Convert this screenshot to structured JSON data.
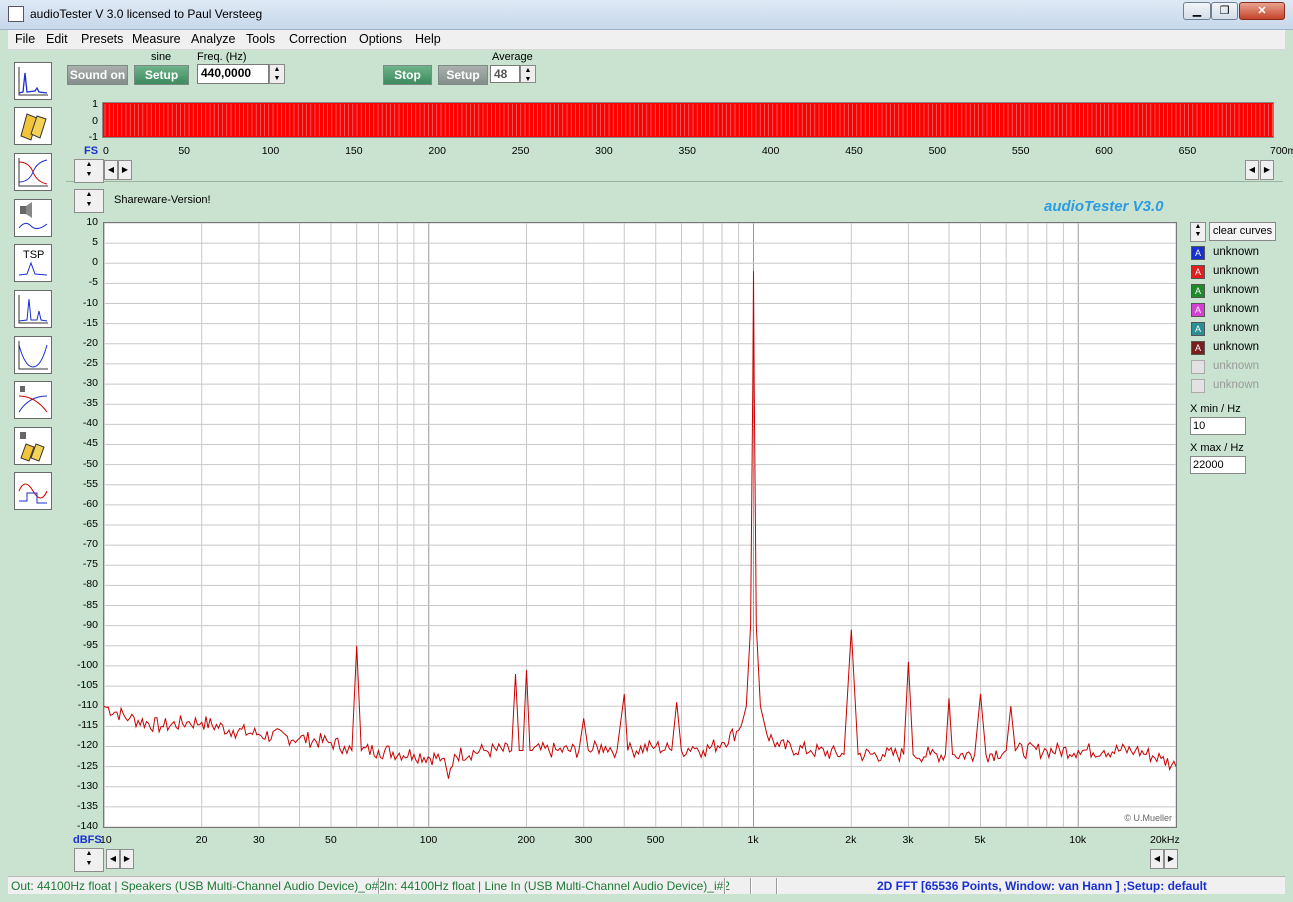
{
  "window": {
    "title": "audioTester  V 3.0   licensed to Paul Versteeg",
    "minimize_icon": "minimize-icon",
    "maximize_icon": "maximize-icon",
    "close_icon": "close-icon"
  },
  "menu": [
    "File",
    "Edit",
    "Presets",
    "Measure",
    "Analyze",
    "Tools",
    "Correction",
    "Options",
    "Help"
  ],
  "toolbar": {
    "sound_on_label": "Sound on",
    "generator_label": "sine",
    "generator_setup_label": "Setup",
    "freq_label": "Freq. (Hz)",
    "freq_value": "440,0000",
    "stop_label": "Stop",
    "analyzer_setup_label": "Setup",
    "average_label": "Average",
    "average_value": "48"
  },
  "sidebar_tools": [
    "spectrum-tool-icon",
    "speakers-tool-icon",
    "frequency-response-tool-icon",
    "speaker-measure-tool-icon",
    "tsp-tool-icon",
    "fft-tool-icon",
    "impedance-tool-icon",
    "crossover-tool-icon",
    "headphone-tool-icon",
    "oscilloscope-tool-icon"
  ],
  "tsp_label": "TSP",
  "scope": {
    "y_ticks": [
      "1",
      "0",
      "-1"
    ],
    "fs_label": "FS",
    "x_ticks": [
      "0",
      "50",
      "100",
      "150",
      "200",
      "250",
      "300",
      "350",
      "400",
      "450",
      "500",
      "550",
      "600",
      "650",
      "700ms"
    ],
    "trace_color": "#ff0000"
  },
  "shareware_label": "Shareware-Version!",
  "brand_label": "audioTester  V3.0",
  "copyright_label": "© U.Mueller",
  "legend": {
    "clear_label": "clear curves",
    "entries": [
      {
        "label": "unknown",
        "color": "#1a2fcf",
        "marker": "A",
        "active": true
      },
      {
        "label": "unknown",
        "color": "#e0201e",
        "marker": "A",
        "active": true
      },
      {
        "label": "unknown",
        "color": "#1e8a2a",
        "marker": "A",
        "active": true
      },
      {
        "label": "unknown",
        "color": "#d43fd4",
        "marker": "A",
        "active": true
      },
      {
        "label": "unknown",
        "color": "#2a8f92",
        "marker": "A",
        "active": true
      },
      {
        "label": "unknown",
        "color": "#7a1e1e",
        "marker": "A",
        "active": true
      },
      {
        "label": "unknown",
        "color": "#bbbbbb",
        "marker": "",
        "active": false
      },
      {
        "label": "unknown",
        "color": "#bbbbbb",
        "marker": "",
        "active": false
      }
    ],
    "xmin_label": "X min / Hz",
    "xmin_value": "10",
    "xmax_label": "X max / Hz",
    "xmax_value": "22000"
  },
  "chart_data": {
    "type": "line",
    "ylabel": "dBFS",
    "xscale": "log",
    "xlim": [
      10,
      20000
    ],
    "ylim": [
      -140,
      10
    ],
    "y_ticks": [
      "10",
      "5",
      "0",
      "-5",
      "-10",
      "-15",
      "-20",
      "-25",
      "-30",
      "-35",
      "-40",
      "-45",
      "-50",
      "-55",
      "-60",
      "-65",
      "-70",
      "-75",
      "-80",
      "-85",
      "-90",
      "-95",
      "-100",
      "-105",
      "-110",
      "-115",
      "-120",
      "-125",
      "-130",
      "-135",
      "-140"
    ],
    "x_ticks": [
      {
        "v": 10,
        "t": "10"
      },
      {
        "v": 20,
        "t": "20"
      },
      {
        "v": 30,
        "t": "30"
      },
      {
        "v": 50,
        "t": "50"
      },
      {
        "v": 100,
        "t": "100"
      },
      {
        "v": 200,
        "t": "200"
      },
      {
        "v": 300,
        "t": "300"
      },
      {
        "v": 500,
        "t": "500"
      },
      {
        "v": 1000,
        "t": "1k"
      },
      {
        "v": 2000,
        "t": "2k"
      },
      {
        "v": 3000,
        "t": "3k"
      },
      {
        "v": 5000,
        "t": "5k"
      },
      {
        "v": 10000,
        "t": "10k"
      },
      {
        "v": 20000,
        "t": "20kHz"
      }
    ],
    "grid": true,
    "series": [
      {
        "color": "#c80000",
        "points": [
          [
            10,
            -110
          ],
          [
            12,
            -113
          ],
          [
            15,
            -115
          ],
          [
            18,
            -114
          ],
          [
            20,
            -114
          ],
          [
            25,
            -116
          ],
          [
            30,
            -117
          ],
          [
            40,
            -118
          ],
          [
            50,
            -119
          ],
          [
            55,
            -120
          ],
          [
            58,
            -121
          ],
          [
            60,
            -95
          ],
          [
            62,
            -121
          ],
          [
            70,
            -121
          ],
          [
            90,
            -122
          ],
          [
            110,
            -123
          ],
          [
            115,
            -128
          ],
          [
            120,
            -122
          ],
          [
            150,
            -121
          ],
          [
            180,
            -121
          ],
          [
            185,
            -102
          ],
          [
            190,
            -121
          ],
          [
            195,
            -121
          ],
          [
            200,
            -101
          ],
          [
            205,
            -121
          ],
          [
            250,
            -121
          ],
          [
            290,
            -121
          ],
          [
            300,
            -113
          ],
          [
            310,
            -121
          ],
          [
            350,
            -120
          ],
          [
            380,
            -121
          ],
          [
            400,
            -107
          ],
          [
            410,
            -121
          ],
          [
            500,
            -120
          ],
          [
            560,
            -121
          ],
          [
            580,
            -109
          ],
          [
            600,
            -121
          ],
          [
            650,
            -120
          ],
          [
            700,
            -121
          ],
          [
            800,
            -119
          ],
          [
            900,
            -116
          ],
          [
            950,
            -110
          ],
          [
            980,
            -90
          ],
          [
            995,
            -30
          ],
          [
            1000,
            -2
          ],
          [
            1005,
            -30
          ],
          [
            1020,
            -90
          ],
          [
            1050,
            -110
          ],
          [
            1100,
            -117
          ],
          [
            1200,
            -120
          ],
          [
            1500,
            -121
          ],
          [
            1900,
            -122
          ],
          [
            2000,
            -91
          ],
          [
            2100,
            -122
          ],
          [
            2500,
            -122
          ],
          [
            2900,
            -122
          ],
          [
            3000,
            -99
          ],
          [
            3100,
            -122
          ],
          [
            3500,
            -122
          ],
          [
            3900,
            -122
          ],
          [
            4000,
            -108
          ],
          [
            4100,
            -122
          ],
          [
            4800,
            -122
          ],
          [
            5000,
            -107
          ],
          [
            5200,
            -122
          ],
          [
            6000,
            -121
          ],
          [
            6200,
            -110
          ],
          [
            6400,
            -121
          ],
          [
            8000,
            -121
          ],
          [
            10000,
            -121
          ],
          [
            12000,
            -121
          ],
          [
            15000,
            -121
          ],
          [
            18000,
            -123
          ],
          [
            20000,
            -125
          ]
        ]
      }
    ]
  },
  "status": {
    "out": "Out: 44100Hz float  | Speakers (USB Multi-Channel Audio Device)_o#2",
    "in": "In: 44100Hz float  | Line In (USB Multi-Channel Audio Device)_i#2",
    "analysis": "2D FFT [65536 Points, Window: van Hann ] ;Setup:  default"
  }
}
